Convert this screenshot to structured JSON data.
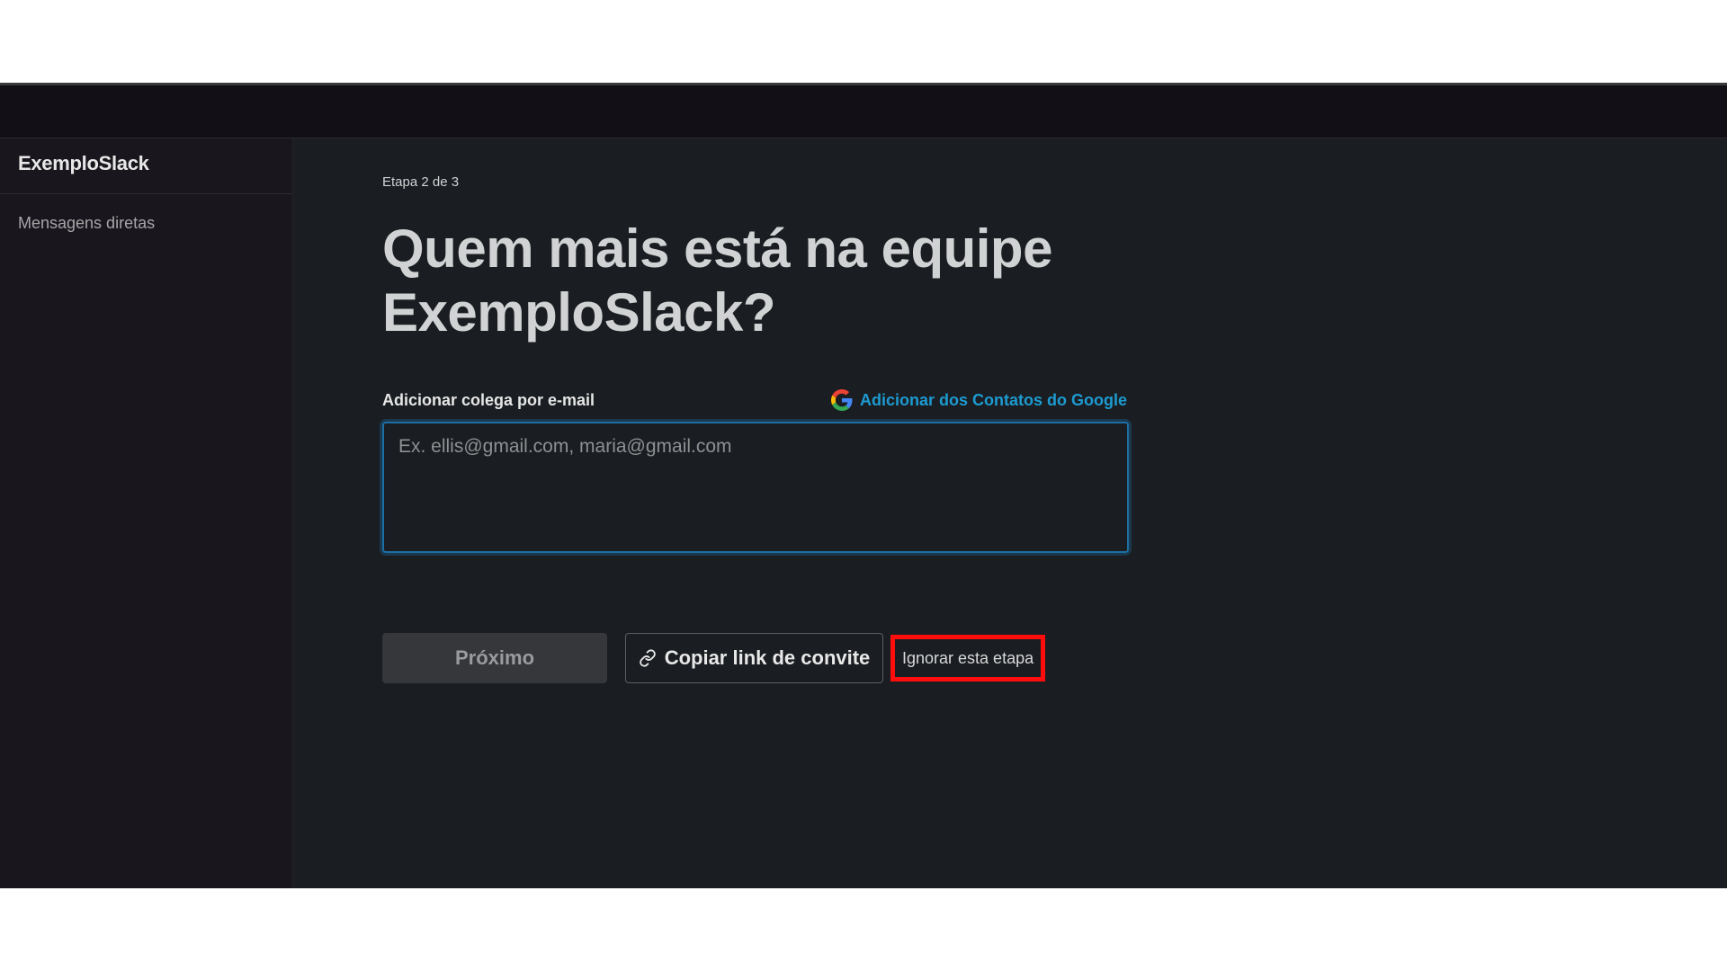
{
  "sidebar": {
    "workspace_name": "ExemploSlack",
    "items": [
      {
        "label": "Mensagens diretas"
      }
    ]
  },
  "main": {
    "step_indicator": "Etapa 2 de 3",
    "headline": "Quem mais está na equipe ExemploSlack?",
    "field_label": "Adicionar colega por e-mail",
    "google_link": "Adicionar dos Contatos do Google",
    "email_input": {
      "value": "",
      "placeholder": "Ex. ellis@gmail.com, maria@gmail.com"
    },
    "buttons": {
      "next": "Próximo",
      "copy_link": "Copiar link de convite",
      "skip": "Ignorar esta etapa"
    }
  },
  "icons": {
    "google": "google-icon",
    "link": "link-icon"
  },
  "colors": {
    "background": "#1a1d21",
    "sidebar": "#19171d",
    "accent_link": "#1d9bd1",
    "input_focus": "#1d6ea3",
    "highlight_box": "#ff0d0d"
  }
}
